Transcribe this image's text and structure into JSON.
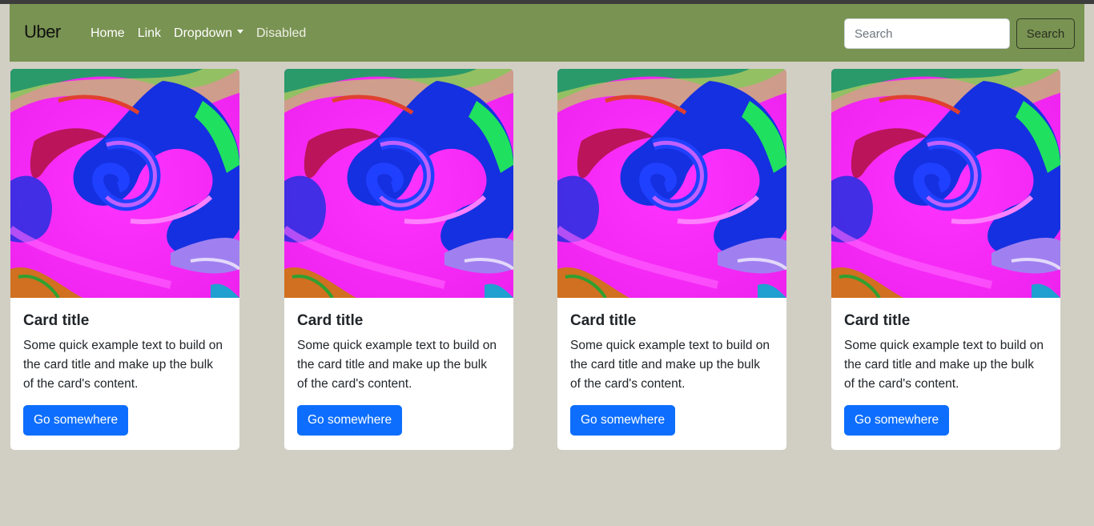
{
  "navbar": {
    "brand": "Uber",
    "links": [
      {
        "label": "Home"
      },
      {
        "label": "Link"
      },
      {
        "label": "Dropdown"
      },
      {
        "label": "Disabled"
      }
    ],
    "search_placeholder": "Search",
    "search_button": "Search",
    "background": "#799352"
  },
  "cards": [
    {
      "title": "Card title",
      "text": "Some quick example text to build on the card title and make up the bulk of the card's content.",
      "button": "Go somewhere"
    },
    {
      "title": "Card title",
      "text": "Some quick example text to build on the card title and make up the bulk of the card's content.",
      "button": "Go somewhere"
    },
    {
      "title": "Card title",
      "text": "Some quick example text to build on the card title and make up the bulk of the card's content.",
      "button": "Go somewhere"
    },
    {
      "title": "Card title",
      "text": "Some quick example text to build on the card title and make up the bulk of the card's content.",
      "button": "Go somewhere"
    }
  ],
  "colors": {
    "page_background": "#d1cfc4",
    "primary_button": "#0d6efd"
  }
}
